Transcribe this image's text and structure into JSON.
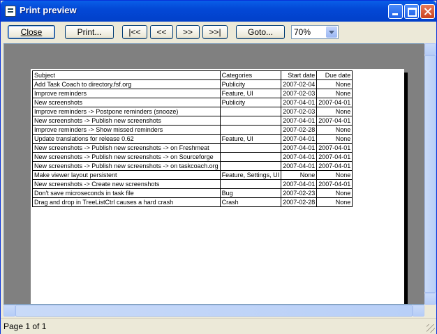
{
  "window": {
    "title": "Print preview"
  },
  "toolbar": {
    "close_label": "Close",
    "print_label": "Print...",
    "first_label": "|<<",
    "prev_label": "<<",
    "next_label": ">>",
    "last_label": ">>|",
    "goto_label": "Goto...",
    "zoom_value": "70%"
  },
  "table": {
    "headers": [
      "Subject",
      "Categories",
      "Start date",
      "Due date"
    ],
    "rows": [
      [
        "Add Task Coach to directory.fsf.org",
        "Publicity",
        "2007-02-04",
        "None"
      ],
      [
        "Improve reminders",
        "Feature, UI",
        "2007-02-03",
        "None"
      ],
      [
        "New screenshots",
        "Publicity",
        "2007-04-01",
        "2007-04-01"
      ],
      [
        "Improve reminders -> Postpone reminders (snooze)",
        "",
        "2007-02-03",
        "None"
      ],
      [
        "New screenshots -> Publish new screenshots",
        "",
        "2007-04-01",
        "2007-04-01"
      ],
      [
        "Improve reminders -> Show missed reminders",
        "",
        "2007-02-28",
        "None"
      ],
      [
        "Update translations for release 0.62",
        "Feature, UI",
        "2007-04-01",
        "None"
      ],
      [
        "New screenshots -> Publish new screenshots -> on Freshmeat",
        "",
        "2007-04-01",
        "2007-04-01"
      ],
      [
        "New screenshots -> Publish new screenshots -> on Sourceforge",
        "",
        "2007-04-01",
        "2007-04-01"
      ],
      [
        "New screenshots -> Publish new screenshots -> on taskcoach.org",
        "",
        "2007-04-01",
        "2007-04-01"
      ],
      [
        "Make viewer layout persistent",
        "Feature, Settings, UI",
        "None",
        "None"
      ],
      [
        "New screenshots -> Create new screenshots",
        "",
        "2007-04-01",
        "2007-04-01"
      ],
      [
        "Don't save microseconds in task file",
        "Bug",
        "2007-02-23",
        "None"
      ],
      [
        "Drag and drop in TreeListCtrl causes a hard crash",
        "Crash",
        "2007-02-28",
        "None"
      ]
    ]
  },
  "status": {
    "text": "Page 1 of 1"
  }
}
